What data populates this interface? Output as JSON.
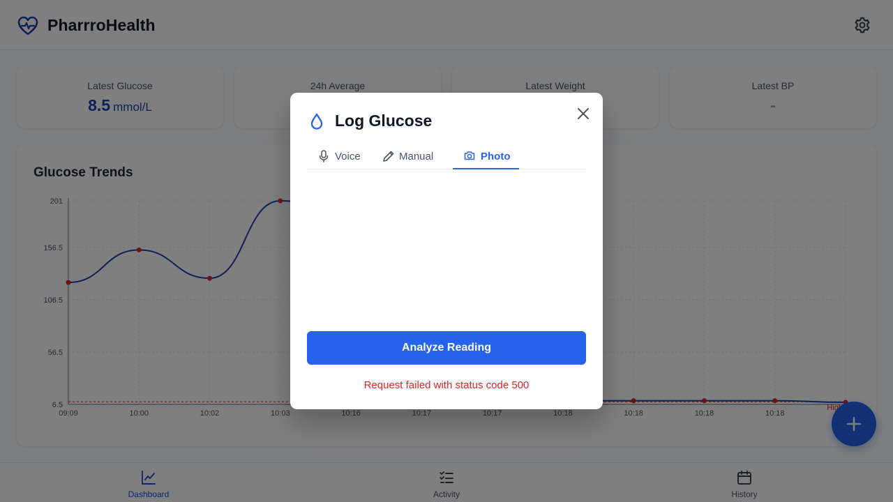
{
  "app": {
    "title": "PharrroHealth"
  },
  "icons": {
    "logo": "heart-pulse-icon",
    "settings": "gear-icon",
    "fab": "plus-icon",
    "drop": "water-drop-icon",
    "close": "close-icon",
    "voice": "microphone-icon",
    "manual": "pencil-icon",
    "photo": "camera-icon",
    "dashboard": "chart-line-icon",
    "activity": "checklist-icon",
    "history": "calendar-icon"
  },
  "colors": {
    "accent": "#2563eb",
    "brand": "#1e40af",
    "error": "#dc2626",
    "point": "#dc2626"
  },
  "stats": [
    {
      "label": "Latest Glucose",
      "value": "8.5",
      "unit": "mmol/L"
    },
    {
      "label": "24h Average",
      "value": "",
      "unit": ""
    },
    {
      "label": "Latest Weight",
      "value": "",
      "unit": ""
    },
    {
      "label": "Latest BP",
      "value": "-",
      "unit": ""
    }
  ],
  "chart": {
    "title": "Glucose Trends"
  },
  "chart_data": {
    "type": "line",
    "title": "Glucose Trends",
    "categories": [
      "09:09",
      "10:00",
      "10:02",
      "10:03",
      "10:16",
      "10:17",
      "10:17",
      "10:18",
      "10:18",
      "10:18",
      "10:18",
      "10:18"
    ],
    "yticks": [
      6.5,
      56.5,
      106.5,
      156.5,
      201
    ],
    "ylim": [
      6.5,
      201
    ],
    "threshold": {
      "value": 9,
      "label": "High"
    },
    "series": [
      {
        "values": [
          123,
          154,
          127,
          201,
          null,
          null,
          null,
          10,
          10,
          10,
          10,
          8.5
        ]
      }
    ],
    "grid": true
  },
  "modal": {
    "title": "Log Glucose",
    "tabs": [
      {
        "label": "Voice"
      },
      {
        "label": "Manual"
      },
      {
        "label": "Photo"
      }
    ],
    "active_tab": "Photo",
    "analyze_label": "Analyze Reading",
    "error": "Request failed with status code 500"
  },
  "nav": [
    {
      "label": "Dashboard"
    },
    {
      "label": "Activity"
    },
    {
      "label": "History"
    }
  ]
}
